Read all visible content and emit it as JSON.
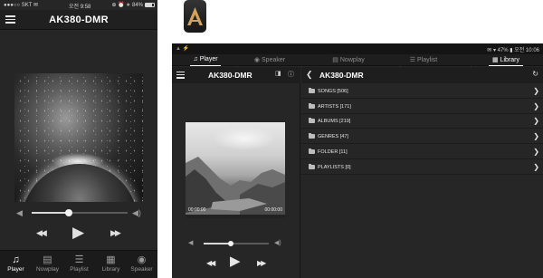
{
  "phone": {
    "status": {
      "carrier": "●●●○○ SKT ✉",
      "time": "오전 9:58",
      "right": "⊕ ⏰ ∗ 84%",
      "battery_level": 0.84
    },
    "title": "AK380-DMR",
    "volume_level": 0.39,
    "tabs": [
      {
        "label": "Player",
        "icon": "music-note-icon",
        "glyph": "♫"
      },
      {
        "label": "Nowplay",
        "icon": "nowplay-icon",
        "glyph": "▤"
      },
      {
        "label": "Playlist",
        "icon": "playlist-icon",
        "glyph": "☰"
      },
      {
        "label": "Library",
        "icon": "library-icon",
        "glyph": "▦"
      },
      {
        "label": "Speaker",
        "icon": "speaker-icon",
        "glyph": "◉"
      }
    ],
    "active_tab": "Player"
  },
  "tablet": {
    "status": {
      "left": "▲ ⚡",
      "right": "✉ ▾ 47% ▮ 오전 10:06"
    },
    "tabs": [
      {
        "label": "Player",
        "glyph": "♫"
      },
      {
        "label": "Speaker",
        "glyph": "◉"
      },
      {
        "label": "Nowplay",
        "glyph": "▤"
      },
      {
        "label": "Playlist",
        "glyph": "☰"
      },
      {
        "label": "Library",
        "glyph": "▦"
      }
    ],
    "player_title": "AK380-DMR",
    "library_title": "AK380-DMR",
    "time_elapsed": "00:00:00",
    "time_total": "00:00:00",
    "volume_level": 0.42,
    "library_items": [
      "SONGS [506]",
      "ARTISTS [171]",
      "ALBUMS [219]",
      "GENRES [47]",
      "FOLDER [11]",
      "PLAYLISTS [0]"
    ]
  },
  "colors": {
    "background": "#262626",
    "header": "#1e1e1e",
    "accent": "#ffffff",
    "logo_gold": "#d3a35a"
  }
}
